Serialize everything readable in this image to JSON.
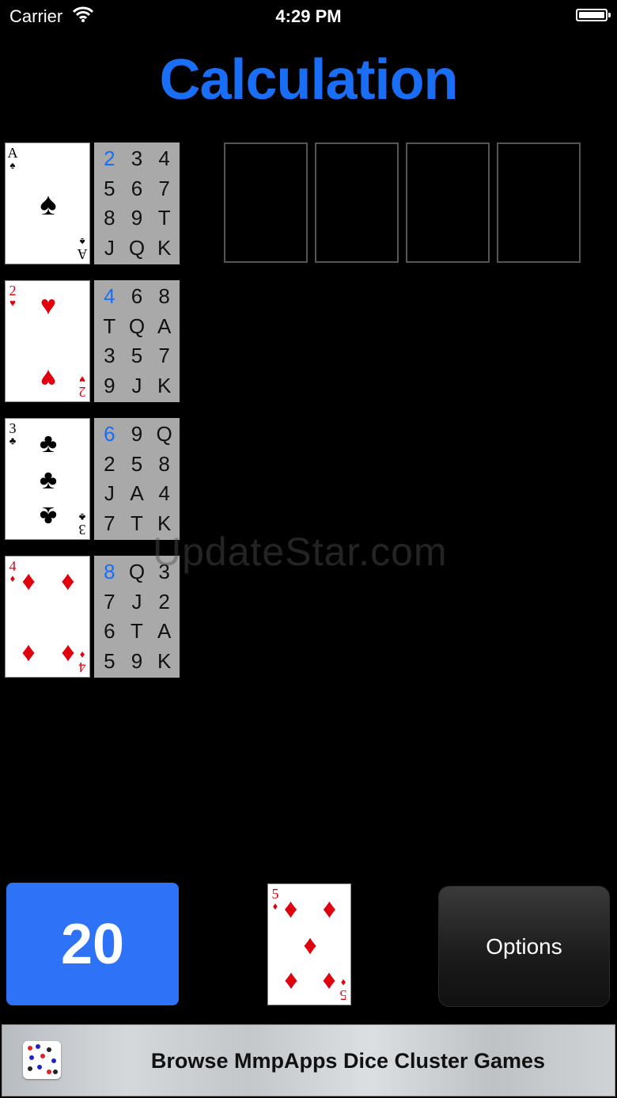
{
  "status": {
    "carrier": "Carrier",
    "time": "4:29 PM"
  },
  "title": "Calculation",
  "foundations": [
    {
      "rank": "A",
      "suit": "♠",
      "color": "black",
      "sequence": [
        "2",
        "3",
        "4",
        "5",
        "6",
        "7",
        "8",
        "9",
        "T",
        "J",
        "Q",
        "K"
      ]
    },
    {
      "rank": "2",
      "suit": "♥",
      "color": "red",
      "sequence": [
        "4",
        "6",
        "8",
        "T",
        "Q",
        "A",
        "3",
        "5",
        "7",
        "9",
        "J",
        "K"
      ]
    },
    {
      "rank": "3",
      "suit": "♣",
      "color": "black",
      "sequence": [
        "6",
        "9",
        "Q",
        "2",
        "5",
        "8",
        "J",
        "A",
        "4",
        "7",
        "T",
        "K"
      ]
    },
    {
      "rank": "4",
      "suit": "♦",
      "color": "red",
      "sequence": [
        "8",
        "Q",
        "3",
        "7",
        "J",
        "2",
        "6",
        "T",
        "A",
        "5",
        "9",
        "K"
      ]
    }
  ],
  "waste_slots": 4,
  "watermark": "UpdateStar.com",
  "score": "20",
  "stock_card": {
    "rank": "5",
    "suit": "♦",
    "color": "red"
  },
  "options_label": "Options",
  "ad_banner": {
    "text": "Browse MmpApps Dice Cluster Games"
  },
  "colors": {
    "accent": "#1a6ef5",
    "score_bg": "#2d72f7",
    "red_suit": "#e0000e"
  }
}
